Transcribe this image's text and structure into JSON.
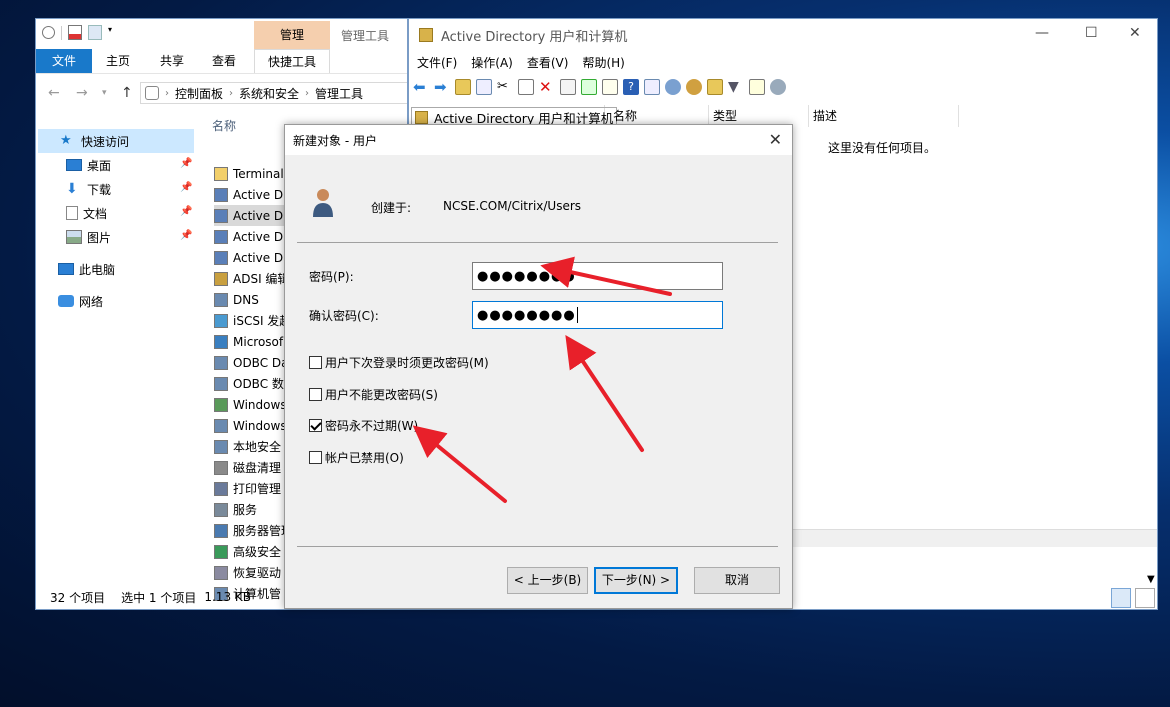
{
  "explorer": {
    "ribbon_context_tab": "管理",
    "ribbon_context_title": "管理工具",
    "tabs": [
      "文件",
      "主页",
      "共享",
      "查看",
      "快捷工具"
    ],
    "breadcrumb": [
      "控制面板",
      "系统和安全",
      "管理工具"
    ],
    "nav": {
      "quick_access": "快速访问",
      "items": [
        "桌面",
        "下载",
        "文档",
        "图片"
      ],
      "this_pc": "此电脑",
      "network": "网络"
    },
    "column_name": "名称",
    "files": [
      "Terminal",
      "Active Di",
      "Active Di",
      "Active Di",
      "Active Di",
      "ADSI 编辑",
      "DNS",
      "iSCSI 发起",
      "Microsof",
      "ODBC Da",
      "ODBC 数",
      "Windows",
      "Windows",
      "本地安全",
      "磁盘清理",
      "打印管理",
      "服务",
      "服务器管理",
      "高级安全",
      "恢复驱动",
      "计算机管"
    ],
    "status": {
      "count": "32 个项目",
      "selected": "选中 1 个项目",
      "size": "1.13 KB"
    }
  },
  "ad": {
    "title": "Active Directory 用户和计算机",
    "menu": [
      "文件(F)",
      "操作(A)",
      "查看(V)",
      "帮助(H)"
    ],
    "tree_root": "Active Directory 用户和计算机",
    "columns": [
      "名称",
      "类型",
      "描述"
    ],
    "empty_message": "这里没有任何项目。"
  },
  "dialog": {
    "title": "新建对象 - 用户",
    "created_in_label": "创建于:",
    "created_in_value": "NCSE.COM/Citrix/Users",
    "password_label": "密码(P):",
    "password_value": "●●●●●●●●",
    "confirm_label": "确认密码(C):",
    "confirm_value": "●●●●●●●●",
    "checkboxes": [
      {
        "label": "用户下次登录时须更改密码(M)",
        "checked": false
      },
      {
        "label": "用户不能更改密码(S)",
        "checked": false
      },
      {
        "label": "密码永不过期(W)",
        "checked": true
      },
      {
        "label": "帐户已禁用(O)",
        "checked": false
      }
    ],
    "back_button": "< 上一步(B)",
    "next_button": "下一步(N) >",
    "cancel_button": "取消"
  },
  "colors": {
    "accent": "#1979ca",
    "annotation": "#e8202a",
    "context_tab": "#f5cfae"
  }
}
